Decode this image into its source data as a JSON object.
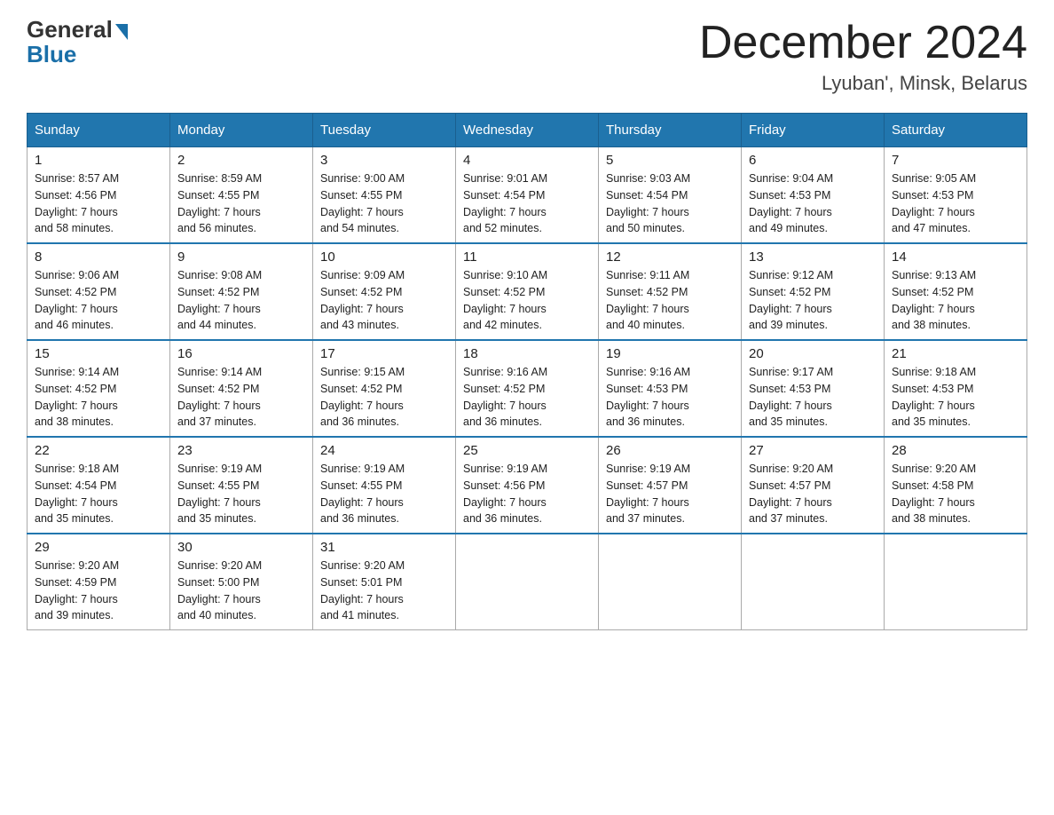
{
  "header": {
    "logo_general": "General",
    "logo_blue": "Blue",
    "month_title": "December 2024",
    "location": "Lyuban', Minsk, Belarus"
  },
  "weekdays": [
    "Sunday",
    "Monday",
    "Tuesday",
    "Wednesday",
    "Thursday",
    "Friday",
    "Saturday"
  ],
  "weeks": [
    [
      {
        "day": "1",
        "info": "Sunrise: 8:57 AM\nSunset: 4:56 PM\nDaylight: 7 hours\nand 58 minutes."
      },
      {
        "day": "2",
        "info": "Sunrise: 8:59 AM\nSunset: 4:55 PM\nDaylight: 7 hours\nand 56 minutes."
      },
      {
        "day": "3",
        "info": "Sunrise: 9:00 AM\nSunset: 4:55 PM\nDaylight: 7 hours\nand 54 minutes."
      },
      {
        "day": "4",
        "info": "Sunrise: 9:01 AM\nSunset: 4:54 PM\nDaylight: 7 hours\nand 52 minutes."
      },
      {
        "day": "5",
        "info": "Sunrise: 9:03 AM\nSunset: 4:54 PM\nDaylight: 7 hours\nand 50 minutes."
      },
      {
        "day": "6",
        "info": "Sunrise: 9:04 AM\nSunset: 4:53 PM\nDaylight: 7 hours\nand 49 minutes."
      },
      {
        "day": "7",
        "info": "Sunrise: 9:05 AM\nSunset: 4:53 PM\nDaylight: 7 hours\nand 47 minutes."
      }
    ],
    [
      {
        "day": "8",
        "info": "Sunrise: 9:06 AM\nSunset: 4:52 PM\nDaylight: 7 hours\nand 46 minutes."
      },
      {
        "day": "9",
        "info": "Sunrise: 9:08 AM\nSunset: 4:52 PM\nDaylight: 7 hours\nand 44 minutes."
      },
      {
        "day": "10",
        "info": "Sunrise: 9:09 AM\nSunset: 4:52 PM\nDaylight: 7 hours\nand 43 minutes."
      },
      {
        "day": "11",
        "info": "Sunrise: 9:10 AM\nSunset: 4:52 PM\nDaylight: 7 hours\nand 42 minutes."
      },
      {
        "day": "12",
        "info": "Sunrise: 9:11 AM\nSunset: 4:52 PM\nDaylight: 7 hours\nand 40 minutes."
      },
      {
        "day": "13",
        "info": "Sunrise: 9:12 AM\nSunset: 4:52 PM\nDaylight: 7 hours\nand 39 minutes."
      },
      {
        "day": "14",
        "info": "Sunrise: 9:13 AM\nSunset: 4:52 PM\nDaylight: 7 hours\nand 38 minutes."
      }
    ],
    [
      {
        "day": "15",
        "info": "Sunrise: 9:14 AM\nSunset: 4:52 PM\nDaylight: 7 hours\nand 38 minutes."
      },
      {
        "day": "16",
        "info": "Sunrise: 9:14 AM\nSunset: 4:52 PM\nDaylight: 7 hours\nand 37 minutes."
      },
      {
        "day": "17",
        "info": "Sunrise: 9:15 AM\nSunset: 4:52 PM\nDaylight: 7 hours\nand 36 minutes."
      },
      {
        "day": "18",
        "info": "Sunrise: 9:16 AM\nSunset: 4:52 PM\nDaylight: 7 hours\nand 36 minutes."
      },
      {
        "day": "19",
        "info": "Sunrise: 9:16 AM\nSunset: 4:53 PM\nDaylight: 7 hours\nand 36 minutes."
      },
      {
        "day": "20",
        "info": "Sunrise: 9:17 AM\nSunset: 4:53 PM\nDaylight: 7 hours\nand 35 minutes."
      },
      {
        "day": "21",
        "info": "Sunrise: 9:18 AM\nSunset: 4:53 PM\nDaylight: 7 hours\nand 35 minutes."
      }
    ],
    [
      {
        "day": "22",
        "info": "Sunrise: 9:18 AM\nSunset: 4:54 PM\nDaylight: 7 hours\nand 35 minutes."
      },
      {
        "day": "23",
        "info": "Sunrise: 9:19 AM\nSunset: 4:55 PM\nDaylight: 7 hours\nand 35 minutes."
      },
      {
        "day": "24",
        "info": "Sunrise: 9:19 AM\nSunset: 4:55 PM\nDaylight: 7 hours\nand 36 minutes."
      },
      {
        "day": "25",
        "info": "Sunrise: 9:19 AM\nSunset: 4:56 PM\nDaylight: 7 hours\nand 36 minutes."
      },
      {
        "day": "26",
        "info": "Sunrise: 9:19 AM\nSunset: 4:57 PM\nDaylight: 7 hours\nand 37 minutes."
      },
      {
        "day": "27",
        "info": "Sunrise: 9:20 AM\nSunset: 4:57 PM\nDaylight: 7 hours\nand 37 minutes."
      },
      {
        "day": "28",
        "info": "Sunrise: 9:20 AM\nSunset: 4:58 PM\nDaylight: 7 hours\nand 38 minutes."
      }
    ],
    [
      {
        "day": "29",
        "info": "Sunrise: 9:20 AM\nSunset: 4:59 PM\nDaylight: 7 hours\nand 39 minutes."
      },
      {
        "day": "30",
        "info": "Sunrise: 9:20 AM\nSunset: 5:00 PM\nDaylight: 7 hours\nand 40 minutes."
      },
      {
        "day": "31",
        "info": "Sunrise: 9:20 AM\nSunset: 5:01 PM\nDaylight: 7 hours\nand 41 minutes."
      },
      {
        "day": "",
        "info": ""
      },
      {
        "day": "",
        "info": ""
      },
      {
        "day": "",
        "info": ""
      },
      {
        "day": "",
        "info": ""
      }
    ]
  ]
}
